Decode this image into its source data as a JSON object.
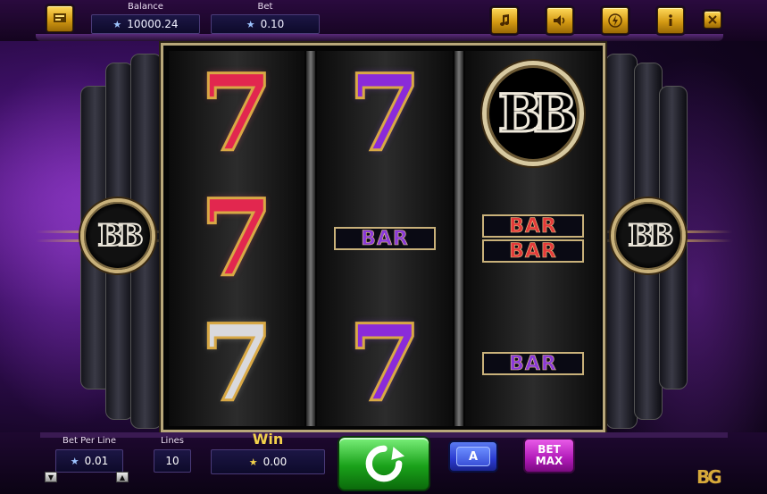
{
  "topbar": {
    "balance_label": "Balance",
    "balance_value": "10000.24",
    "bet_label": "Bet",
    "bet_value": "0.10",
    "buttons": [
      "paytable-icon",
      "music-icon",
      "sound-icon",
      "speed-icon",
      "info-icon",
      "close-icon"
    ]
  },
  "reels": {
    "bar_label": "BAR",
    "bb_label": "BB",
    "columns": [
      [
        "red-seven",
        "red-seven",
        "silver-seven"
      ],
      [
        "purple-seven",
        "single-bar",
        "purple-seven"
      ],
      [
        "bb-logo",
        "double-bar",
        "single-bar"
      ]
    ]
  },
  "side_emblem": "BB",
  "bottombar": {
    "bet_per_line_label": "Bet Per Line",
    "bet_per_line_value": "0.01",
    "lines_label": "Lines",
    "lines_value": "10",
    "win_label": "Win",
    "win_value": "0.00",
    "auto_label": "A",
    "betmax_line1": "BET",
    "betmax_line2": "MAX",
    "logo": "BG"
  },
  "colors": {
    "gold": "#d49a13",
    "spin_green": "#1aa11a",
    "auto_blue": "#2a3ad0",
    "betmax_magenta": "#b01ab8",
    "win_yellow": "#f2d14b"
  }
}
